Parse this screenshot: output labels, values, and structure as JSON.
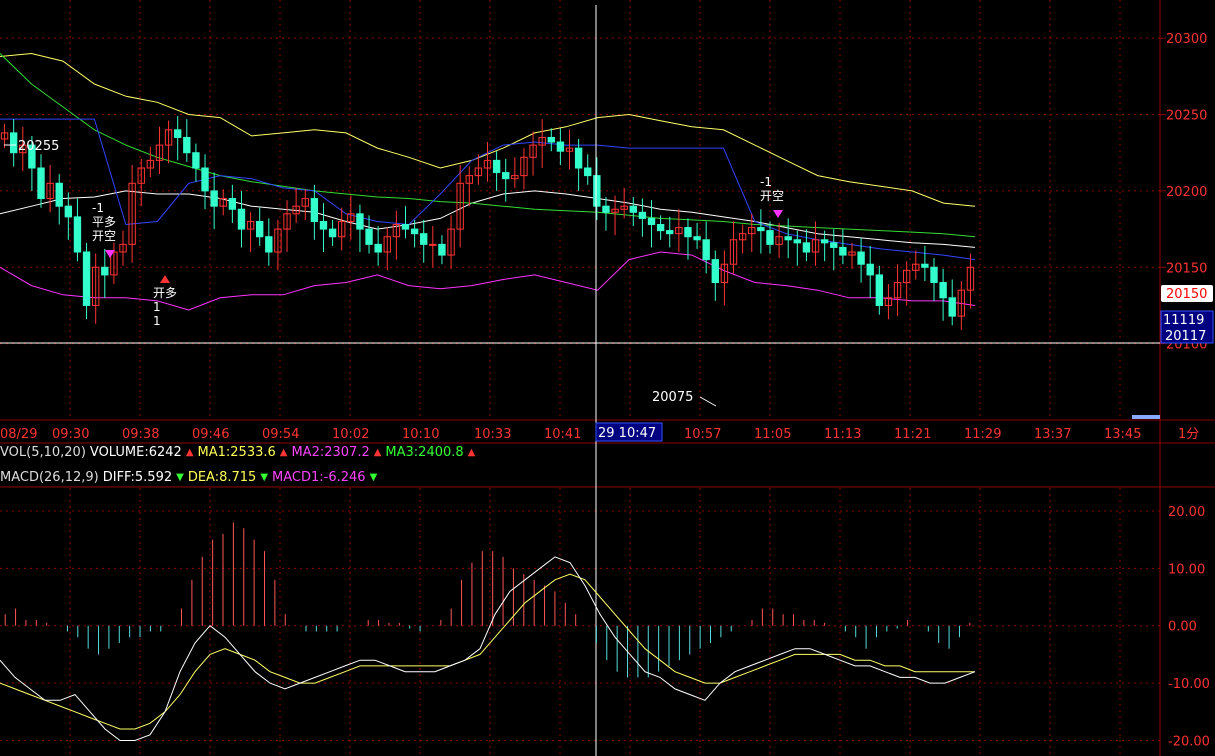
{
  "chart_data": {
    "type": "candlestick",
    "period_label": "1分",
    "y_ticks": [
      20300,
      20250,
      20200,
      20150,
      20100
    ],
    "x_tick_labels": [
      "08/29",
      "09:30",
      "09:38",
      "09:46",
      "09:54",
      "10:02",
      "10:10",
      "10:33",
      "10:41",
      "10:57",
      "11:05",
      "11:13",
      "11:21",
      "11:29",
      "13:37",
      "13:45"
    ],
    "cursor_time_label": "29 10:47",
    "current_price_label": "20150",
    "right_box_labels": [
      "11119",
      "20117"
    ],
    "annotations": {
      "high": "20255",
      "low": "20075",
      "signals": [
        {
          "lines": [
            "-1",
            "平多",
            "开空"
          ],
          "marker": "down"
        },
        {
          "lines": [
            "开多",
            "1",
            "1"
          ],
          "marker": "up"
        },
        {
          "lines": [
            "-1",
            "开空"
          ],
          "marker": "down"
        }
      ]
    },
    "close_series": [
      20238,
      20225,
      20230,
      20215,
      20195,
      20205,
      20190,
      20183,
      20160,
      20125,
      20150,
      20145,
      20160,
      20165,
      20205,
      20215,
      20220,
      20230,
      20240,
      20235,
      20225,
      20215,
      20200,
      20190,
      20195,
      20188,
      20175,
      20180,
      20170,
      20160,
      20175,
      20185,
      20190,
      20195,
      20180,
      20175,
      20170,
      20180,
      20185,
      20175,
      20165,
      20160,
      20170,
      20178,
      20175,
      20172,
      20165,
      20165,
      20158,
      20175,
      20205,
      20210,
      20215,
      20220,
      20212,
      20208,
      20210,
      20222,
      20230,
      20235,
      20232,
      20226,
      20228,
      20215,
      20210,
      20190,
      20186,
      20188,
      20190,
      20186,
      20182,
      20178,
      20174,
      20172,
      20176,
      20170,
      20168,
      20155,
      20140,
      20152,
      20168,
      20172,
      20176,
      20174,
      20165,
      20170,
      20168,
      20166,
      20160,
      20168,
      20166,
      20163,
      20158,
      20160,
      20152,
      20145,
      20125,
      20130,
      20140,
      20148,
      20152,
      20150,
      20140,
      20130,
      20118,
      20135,
      20150
    ],
    "lines": {
      "bollinger_upper": {
        "color": "#ffff66",
        "values": [
          20288,
          20290,
          20285,
          20270,
          20262,
          20258,
          20250,
          20248,
          20236,
          20238,
          20240,
          20238,
          20228,
          20222,
          20215,
          20220,
          20228,
          20238,
          20242,
          20248,
          20250,
          20246,
          20242,
          20240,
          20230,
          20220,
          20210,
          20206,
          20203,
          20200,
          20192,
          20190
        ]
      },
      "bollinger_mid": {
        "color": "#ffffff",
        "values": [
          20185,
          20190,
          20195,
          20196,
          20200,
          20198,
          20198,
          20195,
          20190,
          20188,
          20186,
          20180,
          20175,
          20178,
          20182,
          20192,
          20198,
          20200,
          20198,
          20195,
          20192,
          20188,
          20186,
          20183,
          20180,
          20176,
          20172,
          20170,
          20168,
          20166,
          20165,
          20163
        ]
      },
      "bollinger_lower": {
        "color": "#ff33ff",
        "values": [
          20150,
          20138,
          20132,
          20130,
          20130,
          20128,
          20122,
          20130,
          20132,
          20132,
          20138,
          20140,
          20145,
          20138,
          20136,
          20138,
          20142,
          20145,
          20140,
          20135,
          20155,
          20160,
          20158,
          20148,
          20140,
          20138,
          20135,
          20130,
          20130,
          20128,
          20128,
          20125
        ]
      },
      "ma_long": {
        "color": "#33dd33",
        "values": [
          20290,
          20270,
          20255,
          20240,
          20230,
          20222,
          20216,
          20210,
          20206,
          20203,
          20200,
          20198,
          20196,
          20195,
          20193,
          20192,
          20190,
          20188,
          20187,
          20186,
          20184,
          20182,
          20181,
          20180,
          20178,
          20177,
          20176,
          20175,
          20174,
          20173,
          20172,
          20170
        ]
      },
      "stop_line": {
        "color": "#3344ff",
        "values": [
          20247,
          20247,
          20247,
          20247,
          20178,
          20180,
          20205,
          20210,
          20208,
          20202,
          20200,
          20185,
          20180,
          20178,
          20198,
          20220,
          20230,
          20232,
          20230,
          20230,
          20228,
          20228,
          20228,
          20228,
          20180,
          20172,
          20168,
          20165,
          20162,
          20160,
          20158,
          20155
        ]
      }
    },
    "volume_header": {
      "label": "VOL(5,10,20)",
      "volume": "VOLUME:6242",
      "ma1": "MA1:2533.6",
      "ma2": "MA2:2307.2",
      "ma3": "MA3:2400.8"
    },
    "macd_header": {
      "label": "MACD(26,12,9)",
      "diff": "DIFF:5.592",
      "dea": "DEA:8.715",
      "macd1": "MACD1:-6.246"
    },
    "macd_y_ticks": [
      20,
      10,
      0,
      -10,
      -20
    ],
    "macd_y_tick_labels": [
      "20.00",
      "10.00",
      "0.00",
      "-10.00",
      "-20.00"
    ],
    "macd_hist": [
      2,
      3,
      1,
      1,
      0.5,
      0,
      -1,
      -2,
      -4,
      -5,
      -4,
      -3,
      -2,
      -2,
      -1,
      -1,
      0,
      3,
      8,
      12,
      15,
      16,
      18,
      17,
      15,
      13,
      8,
      2,
      0,
      -1,
      -1,
      -1,
      -1,
      0,
      0,
      1,
      1,
      0.5,
      0.5,
      -0.5,
      -1,
      0,
      1,
      3,
      8,
      11,
      13,
      13,
      12,
      10,
      9,
      8,
      7,
      6,
      4,
      2,
      0,
      -3,
      -6,
      -8,
      -9,
      -9,
      -9,
      -8,
      -7,
      -6,
      -5,
      -4,
      -3,
      -2,
      -1,
      0,
      1,
      3,
      3,
      2,
      2,
      1,
      1,
      0.5,
      0,
      -1,
      -2,
      -4,
      -2,
      -1,
      -0.5,
      1,
      0,
      -1,
      -3,
      -4,
      -2,
      0.5
    ],
    "macd_diff": [
      -6,
      -9,
      -11,
      -13,
      -13,
      -12,
      -15,
      -18,
      -20,
      -20,
      -19,
      -15,
      -8,
      -3,
      0,
      -2,
      -5,
      -8,
      -10,
      -11,
      -10,
      -9,
      -8,
      -7,
      -6,
      -6,
      -7,
      -8,
      -8,
      -8,
      -7,
      -6,
      -4,
      2,
      6,
      8,
      10,
      12,
      11,
      7,
      2,
      -2,
      -5,
      -8,
      -9,
      -11,
      -12,
      -13,
      -10,
      -8,
      -7,
      -6,
      -5,
      -4,
      -4,
      -5,
      -6,
      -7,
      -7,
      -8,
      -9,
      -9,
      -10,
      -10,
      -9,
      -8
    ],
    "macd_dea": [
      -10,
      -11,
      -12,
      -13,
      -14,
      -15,
      -16,
      -17,
      -18,
      -18,
      -17,
      -15,
      -12,
      -8,
      -5,
      -4,
      -5,
      -6,
      -8,
      -9,
      -10,
      -10,
      -9,
      -8,
      -7,
      -7,
      -7,
      -7,
      -7,
      -7,
      -7,
      -6,
      -5,
      -2,
      1,
      4,
      6,
      8,
      9,
      8,
      5,
      2,
      -1,
      -4,
      -6,
      -8,
      -9,
      -10,
      -10,
      -9,
      -8,
      -7,
      -6,
      -5,
      -5,
      -5,
      -5,
      -6,
      -6,
      -7,
      -7,
      -8,
      -8,
      -8,
      -8,
      -8
    ],
    "colors": {
      "up": "#ff3333",
      "down": "#33ffcc",
      "grid": "#8b0000",
      "axis_text": "#ff3333",
      "macd_up": "#ff5555",
      "macd_down": "#55dddd",
      "diff_line": "#ffffff",
      "dea_line": "#ffff66"
    }
  }
}
